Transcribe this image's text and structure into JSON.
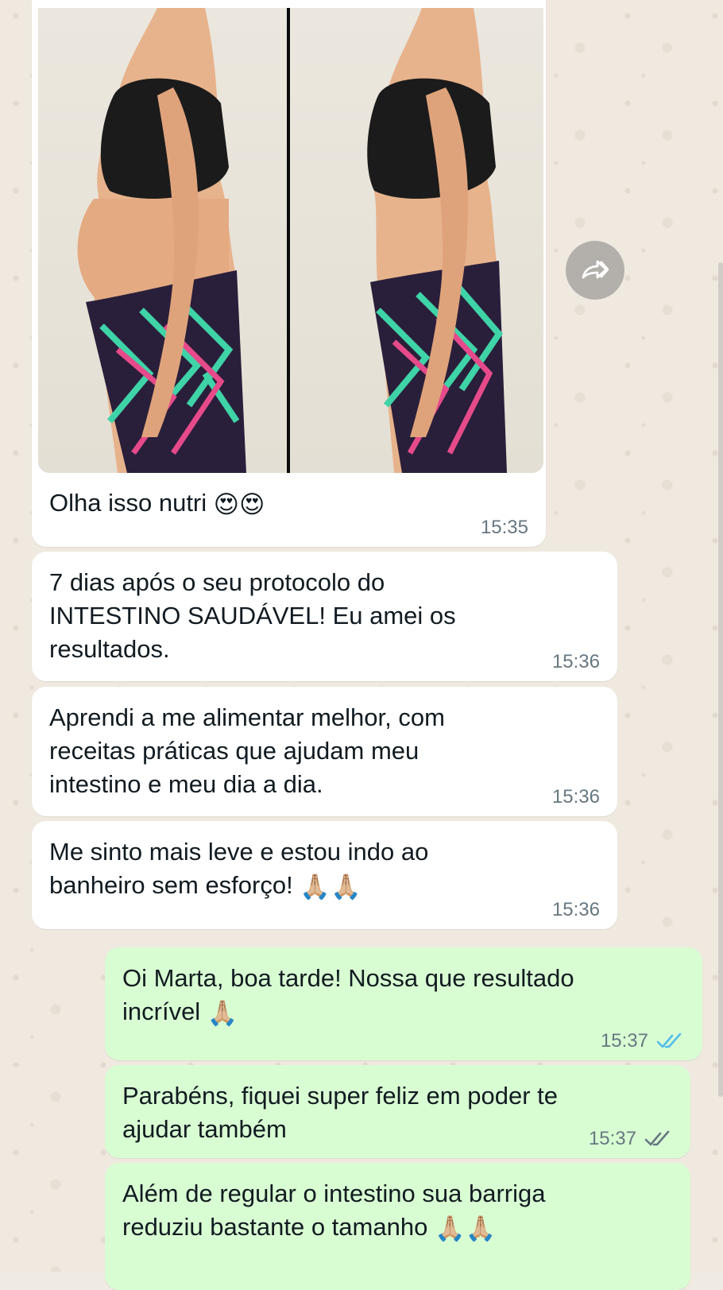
{
  "messages": [
    {
      "id": "m1",
      "direction": "incoming",
      "type": "image",
      "caption": "Olha isso nutri",
      "emoji": "😍😍",
      "time": "15:35"
    },
    {
      "id": "m2",
      "direction": "incoming",
      "text": "7 dias após o seu protocolo do\nINTESTINO SAUDÁVEL! Eu amei os\nresultados.",
      "time": "15:36"
    },
    {
      "id": "m3",
      "direction": "incoming",
      "text": "Aprendi a me alimentar melhor, com\nreceitas práticas que ajudam meu\nintestino e meu dia a dia.",
      "time": "15:36"
    },
    {
      "id": "m4",
      "direction": "incoming",
      "text": "Me sinto mais leve e estou indo ao\nbanheiro sem esforço!",
      "emoji": "🙏🏼🙏🏼",
      "time": "15:36"
    },
    {
      "id": "m5",
      "direction": "outgoing",
      "text": "Oi Marta, boa tarde! Nossa que resultado\nincrível",
      "emoji": "🙏🏼",
      "time": "15:37",
      "status": "read"
    },
    {
      "id": "m6",
      "direction": "outgoing",
      "text": "Parabéns, fiquei super feliz em poder te\najudar também",
      "time": "15:37",
      "status": "delivered"
    },
    {
      "id": "m7",
      "direction": "outgoing",
      "text": "Além de regular o intestino sua barriga\nreduziu bastante o tamanho",
      "emoji": "🙏🏼🙏🏼"
    }
  ],
  "icons": {
    "forward": "forward-icon",
    "read_ticks": "double-check-icon",
    "delivered_ticks": "double-check-icon"
  },
  "colors": {
    "incoming_bubble": "#ffffff",
    "outgoing_bubble": "#d9fdd3",
    "read_tick": "#53bdeb",
    "delivered_tick": "#667781",
    "time_text": "#667781"
  }
}
